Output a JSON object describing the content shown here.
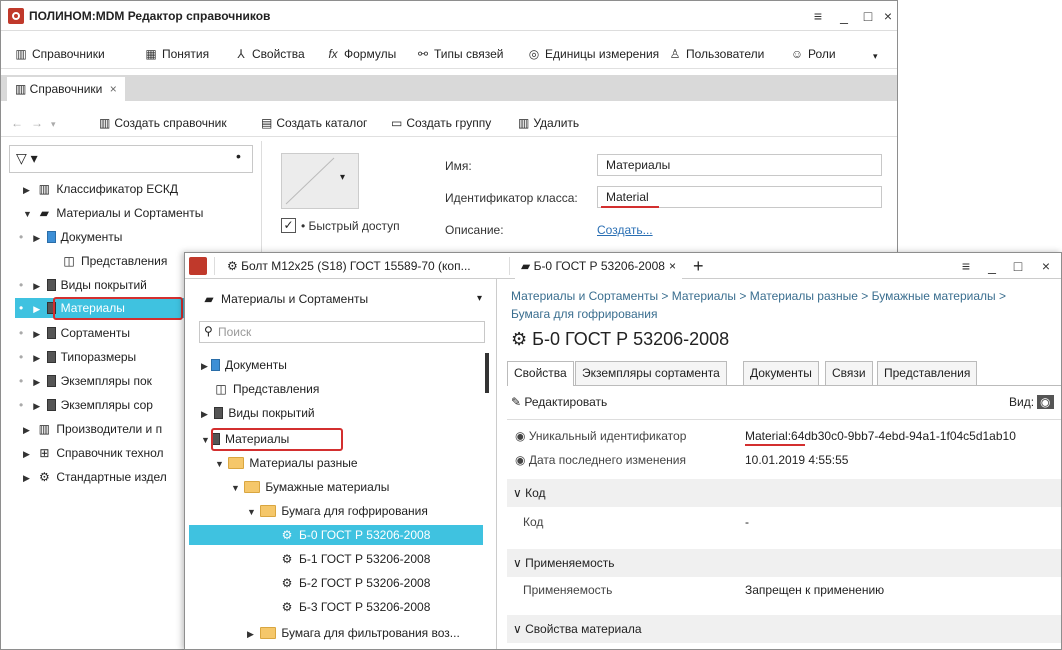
{
  "window_a": {
    "title": "ПОЛИНОМ:MDM Редактор справочников",
    "menu": [
      "Справочники",
      "Понятия",
      "Свойства",
      "Формулы",
      "Типы связей",
      "Единицы измерения",
      "Пользователи",
      "Роли"
    ],
    "menu_formula_prefix": "fx",
    "doc_tab": "Справочники",
    "toolbar": {
      "create_reference": "Создать справочник",
      "create_catalog": "Создать каталог",
      "create_group": "Создать группу",
      "delete": "Удалить"
    },
    "tree": [
      {
        "label": "Классификатор ЕСКД"
      },
      {
        "label": "Материалы и Сортаменты"
      },
      {
        "label": "Документы"
      },
      {
        "label": "Представления"
      },
      {
        "label": "Виды покрытий"
      },
      {
        "label": "Материалы"
      },
      {
        "label": "Сортаменты"
      },
      {
        "label": "Типоразмеры"
      },
      {
        "label": "Экземпляры пок"
      },
      {
        "label": "Экземпляры сор"
      },
      {
        "label": "Производители и п"
      },
      {
        "label": "Справочник технол"
      },
      {
        "label": "Стандартные издел"
      }
    ],
    "form": {
      "name_label": "Имя:",
      "name_value": "Материалы",
      "class_id_label": "Идентификатор класса:",
      "class_id_value": "Material",
      "desc_label": "Описание:",
      "desc_link": "Создать...",
      "quick_access": "• Быстрый доступ"
    }
  },
  "window_b": {
    "tabs": [
      "Болт M12x25 (S18) ГОСТ 15589-70 (коп...",
      "Б-0 ГОСТ Р 53206-2008"
    ],
    "tree_root": "Материалы и Сортаменты",
    "search_placeholder": "Поиск",
    "tree": [
      {
        "label": "Документы"
      },
      {
        "label": "Представления"
      },
      {
        "label": "Виды покрытий"
      },
      {
        "label": "Материалы"
      },
      {
        "label": "Материалы разные"
      },
      {
        "label": "Бумажные материалы"
      },
      {
        "label": "Бумага для гофрирования"
      },
      {
        "label": "Б-0 ГОСТ Р 53206-2008"
      },
      {
        "label": "Б-1 ГОСТ Р 53206-2008"
      },
      {
        "label": "Б-2 ГОСТ Р 53206-2008"
      },
      {
        "label": "Б-3 ГОСТ Р 53206-2008"
      },
      {
        "label": "Бумага для фильтрования воз..."
      }
    ],
    "breadcrumb_line1": "Материалы и Сортаменты > Материалы > Материалы разные > Бумажные материалы >",
    "breadcrumb_line2": "Бумага для гофрирования",
    "item_title": "Б-0 ГОСТ Р 53206-2008",
    "prop_tabs": [
      "Свойства",
      "Экземпляры сортамента",
      "Документы",
      "Связи",
      "Представления"
    ],
    "edit_label": "Редактировать",
    "view_label": "Вид:",
    "uid_label": "Уникальный идентификатор",
    "uid_prefix": "Material",
    "uid_rest": ":64db30c0-9bb7-4ebd-94a1-1f04c5d1ab10",
    "date_label": "Дата последнего изменения",
    "date_value": "10.01.2019 4:55:55",
    "sections": [
      {
        "title": "Код",
        "prop": "Код",
        "value": "-"
      },
      {
        "title": "Применяемость",
        "prop": "Применяемость",
        "value": "Запрещен к применению"
      },
      {
        "title": "Свойства материала"
      }
    ]
  },
  "colors": {
    "selection": "#3fc2e0",
    "highlight_box": "#d32f2f",
    "link": "#2a6fb4"
  }
}
